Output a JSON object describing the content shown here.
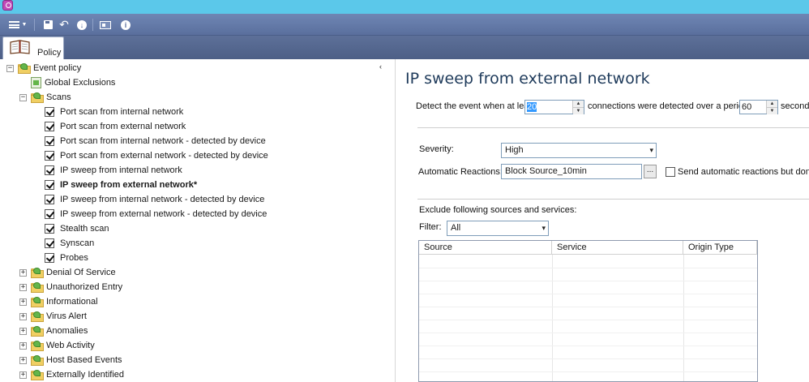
{
  "toolbar": {
    "buttons": [
      "menu-icon",
      "save-icon",
      "undo-icon",
      "download-icon",
      "id-card-icon",
      "info-icon"
    ],
    "info_glyph": "i"
  },
  "tab": {
    "label": "Policy"
  },
  "tree": {
    "collapse_glyph": "‹",
    "root": {
      "label": "Event policy",
      "expander": "−"
    },
    "global_exclusions": {
      "label": "Global Exclusions"
    },
    "scans": {
      "label": "Scans",
      "expander": "−",
      "items": [
        {
          "label": "Port scan from internal network",
          "checked": true,
          "selected": false
        },
        {
          "label": "Port scan from external network",
          "checked": true,
          "selected": false
        },
        {
          "label": "Port scan from internal network - detected by device",
          "checked": true,
          "selected": false
        },
        {
          "label": "Port scan from external network - detected by device",
          "checked": true,
          "selected": false
        },
        {
          "label": "IP sweep from internal network",
          "checked": true,
          "selected": false
        },
        {
          "label": "IP sweep from external network*",
          "checked": true,
          "selected": true
        },
        {
          "label": "IP sweep from internal network - detected by device",
          "checked": true,
          "selected": false
        },
        {
          "label": "IP sweep from external network - detected by device",
          "checked": true,
          "selected": false
        },
        {
          "label": "Stealth scan",
          "checked": true,
          "selected": false
        },
        {
          "label": "Synscan",
          "checked": true,
          "selected": false
        },
        {
          "label": "Probes",
          "checked": true,
          "selected": false
        }
      ]
    },
    "groups": [
      {
        "label": "Denial Of Service",
        "expander": "+"
      },
      {
        "label": "Unauthorized Entry",
        "expander": "+"
      },
      {
        "label": "Informational",
        "expander": "+"
      },
      {
        "label": "Virus Alert",
        "expander": "+"
      },
      {
        "label": "Anomalies",
        "expander": "+"
      },
      {
        "label": "Web Activity",
        "expander": "+"
      },
      {
        "label": "Host Based Events",
        "expander": "+"
      },
      {
        "label": "Externally Identified",
        "expander": "+"
      }
    ]
  },
  "detail": {
    "title": "IP sweep from external network",
    "detect_prefix": "Detect the event when at least",
    "connections_value": "20",
    "detect_middle": "connections were detected over a period of",
    "period_value": "60",
    "detect_suffix": "seconds",
    "severity_label": "Severity:",
    "severity_value": "High",
    "reactions_label": "Automatic Reactions:",
    "reactions_value": "Block Source_10min",
    "browse_label": "...",
    "send_auto_label": "Send automatic reactions but don't gen",
    "exclude_label": "Exclude following sources and services:",
    "filter_label": "Filter:",
    "filter_value": "All",
    "columns": [
      "Source",
      "Service",
      "Origin Type"
    ]
  },
  "colors": {
    "titlebar": "#5bc8ea",
    "toolbar": "#5a6f9d",
    "heading": "#1f3b5b",
    "selection": "#3399ff"
  }
}
